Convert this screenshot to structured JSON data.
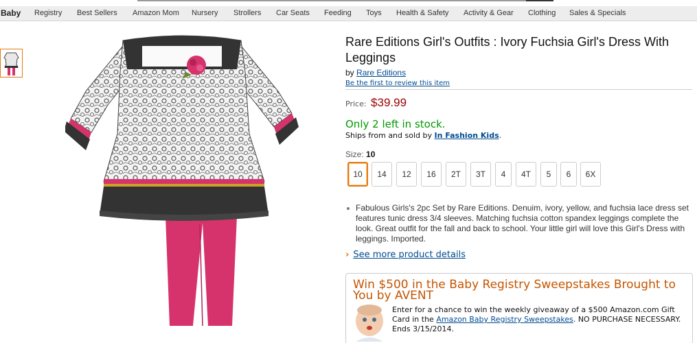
{
  "nav": {
    "brand": "Baby",
    "items": [
      "Registry",
      "Best Sellers",
      "Amazon Mom",
      "Nursery",
      "Strollers",
      "Car Seats",
      "Feeding",
      "Toys",
      "Health & Safety",
      "Activity & Gear",
      "Clothing",
      "Sales & Specials"
    ]
  },
  "product": {
    "title": "Rare Editions Girl's Outfits : Ivory Fuchsia Girl's Dress With Leggings",
    "by_prefix": "by",
    "brand": "Rare Editions",
    "review_link": "Be the first to review this item",
    "price_label": "Price:",
    "price": "$39.99",
    "stock": "Only 2 left in stock.",
    "ships_prefix": "Ships from and sold by",
    "seller": "In Fashion Kids",
    "ships_suffix": ".",
    "size_label": "Size:",
    "size_selected": "10",
    "sizes": [
      "10",
      "14",
      "12",
      "16",
      "2T",
      "3T",
      "4",
      "4T",
      "5",
      "6",
      "6X"
    ],
    "description": "Fabulous Girls's 2pc Set by Rare Editions. Denuim, ivory, yellow, and fuchsia lace dress set features tunic dress 3/4 sleeves. Matching fuchsia cotton spandex leggings complete the look. Great outfit for the fall and back to school. Your little girl will love this Girl's Dress with leggings. Imported.",
    "more_details": "See more product details"
  },
  "promo": {
    "title": "Win $500 in the Baby Registry Sweepstakes Brought to You by AVENT",
    "body_prefix": "Enter for a chance to win the weekly giveaway of a $500 Amazon.com Gift Card in the",
    "link": "Amazon Baby Registry Sweepstakes",
    "body_suffix": ". NO PURCHASE NECESSARY. Ends 3/15/2014."
  },
  "colors": {
    "price": "#990000",
    "stock": "#009900",
    "link": "#004b91",
    "accent": "#e47911",
    "promo_title": "#c45500",
    "fuchsia": "#d6336c"
  }
}
